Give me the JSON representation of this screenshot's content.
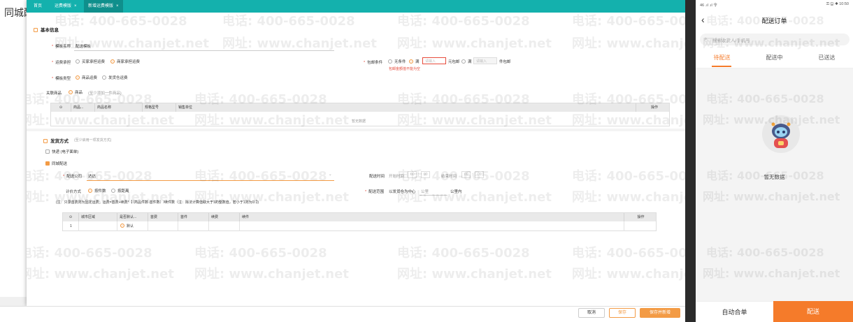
{
  "background": {
    "title": "同城配"
  },
  "tabs": [
    {
      "label": "首页",
      "closable": false
    },
    {
      "label": "运费模版",
      "closable": true
    },
    {
      "label": "新增运费模版",
      "closable": true
    }
  ],
  "basic": {
    "section_title": "基本信息",
    "template_name_label": "模板名称",
    "template_name_value": "配送模板",
    "fee_method_label": "运费承担",
    "fee_opt_buyer": "买家承担运费",
    "fee_opt_seller": "商家承担运费",
    "template_type_label": "模板类型",
    "type_opt_product": "商品运费",
    "type_opt_warehouse": "发货仓运费",
    "free_cond_label": "包邮条件",
    "free_opt_none": "无条件",
    "free_opt_full": "满",
    "free_placeholder1": "请输入",
    "free_unit1": "元包邮",
    "free_opt_full2": "满",
    "free_placeholder2": "请输入",
    "free_unit2": "件包邮",
    "free_error": "包邮金额值不能为空",
    "related_label": "关联商品",
    "related_opt": "商品",
    "related_hint": "(至少添加一件商品)",
    "goods_table": {
      "headers": [
        "商品...",
        "商品名称",
        "规格型号",
        "销售单位",
        "操作"
      ],
      "empty": "暂无数据"
    }
  },
  "delivery": {
    "section_title": "发货方式",
    "section_hint": "(至少启用一项发货方式)",
    "express_label": "快递 (电子面单)",
    "local_label": "同城配送",
    "company_label": "配送公司",
    "company_value": "达达",
    "time_label": "配送时间",
    "time_start_label": "开始时间",
    "time_start_h": "00",
    "time_start_m": "00",
    "time_end_label": "结束时间",
    "time_end_h": "00",
    "time_end_m": "00",
    "pricing_label": "计价方式",
    "pricing_opt_piece": "按件数",
    "pricing_opt_distance": "按距离",
    "range_label": "配送范围",
    "range_prefix": "以发货仓为中心",
    "range_placeholder": "公里",
    "range_suffix": "公里内",
    "note": "(注：只录首费则为固定运费；运费=首费+续费*【（商品件数-首件数）/续件数（注：除法计算值取大于1的整数值，若小于1则为0）】)",
    "fee_table": {
      "headers": [
        "城市区域",
        "是否默认...",
        "首费",
        "首件",
        "续费",
        "续件",
        "操作"
      ],
      "row_index": "1",
      "row_default": "默认"
    }
  },
  "footer": {
    "cancel": "取消",
    "save": "保存",
    "save_new": "保存并新增"
  },
  "watermark": {
    "phone": "电话: 400-665-0028",
    "site": "网址: www.chanjet.net"
  },
  "phone": {
    "status_left": "46 .ıl .ıl 令",
    "status_right": "⚿ ⓝ ✱ 10:50",
    "title": "配送订单",
    "search_placeholder": "搜索收货人/手机号",
    "tabs": [
      "待配送",
      "配送中",
      "已送达"
    ],
    "empty_text": "暂无数据",
    "btn_merge": "自动合单",
    "btn_deliver": "配送"
  },
  "colors": {
    "accent": "#f39b45",
    "tabbar": "#14b1ad",
    "phone_accent": "#f57b2a"
  }
}
